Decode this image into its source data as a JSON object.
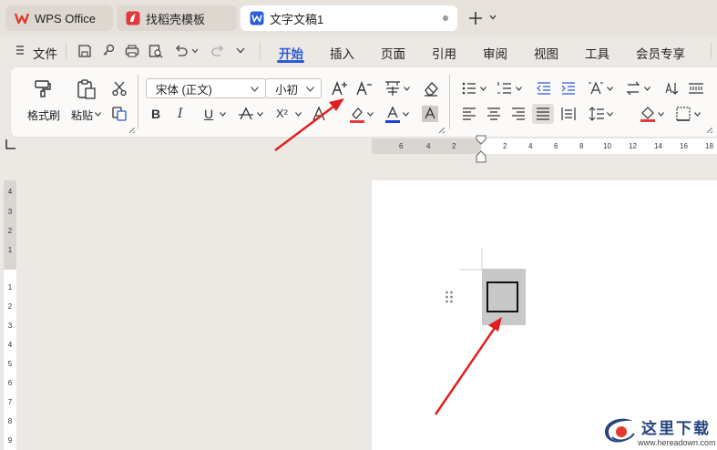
{
  "tabs": [
    {
      "label": "WPS Office",
      "icon": "wps-logo-icon",
      "active": false
    },
    {
      "label": "找稻壳模板",
      "icon": "docer-logo-icon",
      "active": false
    },
    {
      "label": "文字文稿1",
      "icon": "writer-logo-icon",
      "active": true
    }
  ],
  "menubar": {
    "file_label": "文件",
    "items": [
      "开始",
      "插入",
      "页面",
      "引用",
      "审阅",
      "视图",
      "工具",
      "会员专享"
    ],
    "active": "开始"
  },
  "ribbon": {
    "format_painter_label": "格式刷",
    "paste_label": "粘贴",
    "font_name": "宋体 (正文)",
    "font_size": "小初",
    "bold": "B",
    "italic": "I",
    "underline": "U",
    "strike": "ꟻ",
    "superscript": "X²",
    "font_color_accent": "#1f3fd6",
    "highlight_accent": "#e03b3b"
  },
  "ruler": {
    "left_ticks": [
      "6",
      "4",
      "2"
    ],
    "right_ticks": [
      "2",
      "4",
      "6",
      "8",
      "10",
      "12",
      "14",
      "16",
      "18"
    ],
    "vertical_ticks": [
      "4",
      "3",
      "2",
      "1",
      "1",
      "2",
      "3",
      "4",
      "5",
      "6",
      "7",
      "8",
      "9"
    ]
  },
  "watermark": {
    "text": "这里下载",
    "url": "www.hereadown.com"
  },
  "colors": {
    "accent": "#2b5bd7",
    "annotation_arrow": "#e02020"
  }
}
